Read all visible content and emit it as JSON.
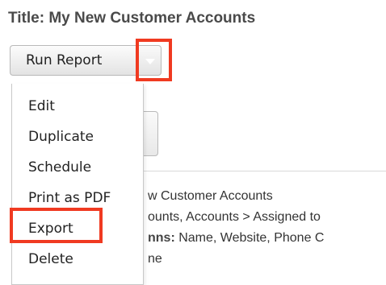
{
  "report": {
    "title": "Title: My New Customer Accounts"
  },
  "toolbar": {
    "run_report_label": "Run Report",
    "caret_icon": "caret-down-icon"
  },
  "menu": {
    "items": [
      {
        "label": "Edit"
      },
      {
        "label": "Duplicate"
      },
      {
        "label": "Schedule"
      },
      {
        "label": "Print as PDF"
      },
      {
        "label": "Export"
      },
      {
        "label": "Delete"
      }
    ]
  },
  "details": {
    "line1": "w Customer Accounts",
    "line2": "ounts, Accounts > Assigned to",
    "line3_bold": "nns:",
    "line3_rest": " Name, Website, Phone C",
    "line4": "ne"
  },
  "colors": {
    "highlight": "#f03a21",
    "title": "#4a4a4a",
    "caret": "#ffffff"
  }
}
